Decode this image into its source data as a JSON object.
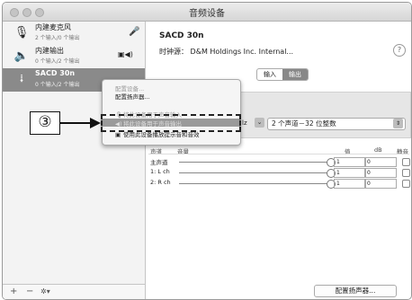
{
  "window": {
    "title": "音频设备"
  },
  "sidebar": {
    "devices": [
      {
        "name": "内建麦克风",
        "sub": "2 个输入/0 个输出",
        "icon": "microphone-icon",
        "right_icon": "mic-small-icon"
      },
      {
        "name": "内建输出",
        "sub": "0 个输入/2 个输出",
        "icon": "speaker-icon",
        "right_icon": "display-speaker-icon"
      },
      {
        "name": "SACD 30n",
        "sub": "0 个输入/2 个输出",
        "icon": "usb-icon",
        "right_icon": ""
      }
    ],
    "add_button": "+",
    "remove_button": "−",
    "gear_button": "✲▾"
  },
  "main": {
    "device_title": "SACD 30n",
    "clock_source_label": "时钟源：",
    "clock_source_value": "D&M Holdings Inc. Internal...",
    "help": "?",
    "tabs": [
      {
        "label": "输入",
        "active": false
      },
      {
        "label": "输出",
        "active": true
      }
    ],
    "format_hz": "lz",
    "format_value": "2 个声道－32 位整数",
    "columns": {
      "channel": "声道",
      "volume": "音量",
      "value": "值",
      "db": "dB",
      "mute": "静音"
    },
    "channels": [
      {
        "name": "主声道",
        "volume": 1.0,
        "value": "1",
        "db": "0"
      },
      {
        "name": "1: L ch",
        "volume": 1.0,
        "value": "1",
        "db": "0"
      },
      {
        "name": "2: R ch",
        "volume": 1.0,
        "value": "1",
        "db": "0"
      }
    ],
    "configure_speakers_button": "配置扬声器..."
  },
  "context_menu": {
    "items": [
      {
        "label": "配置设备...",
        "disabled": true,
        "icon": ""
      },
      {
        "label": "配置扬声器...",
        "disabled": false,
        "icon": ""
      },
      {
        "label": "将此设备用于声音输入",
        "disabled": true,
        "icon": "microphone-icon"
      },
      {
        "label": "将此设备用于声音输出",
        "disabled": false,
        "highlighted": true,
        "icon": "speaker-icon"
      },
      {
        "label": "使用此设备播放提示音和音效",
        "disabled": false,
        "icon": "alert-speaker-icon"
      }
    ]
  },
  "annotation": {
    "step_label": "③"
  },
  "colors": {
    "selection": "#8a8a8a",
    "tab_active": "#888888",
    "menu_highlight": "#9a9a9a"
  }
}
